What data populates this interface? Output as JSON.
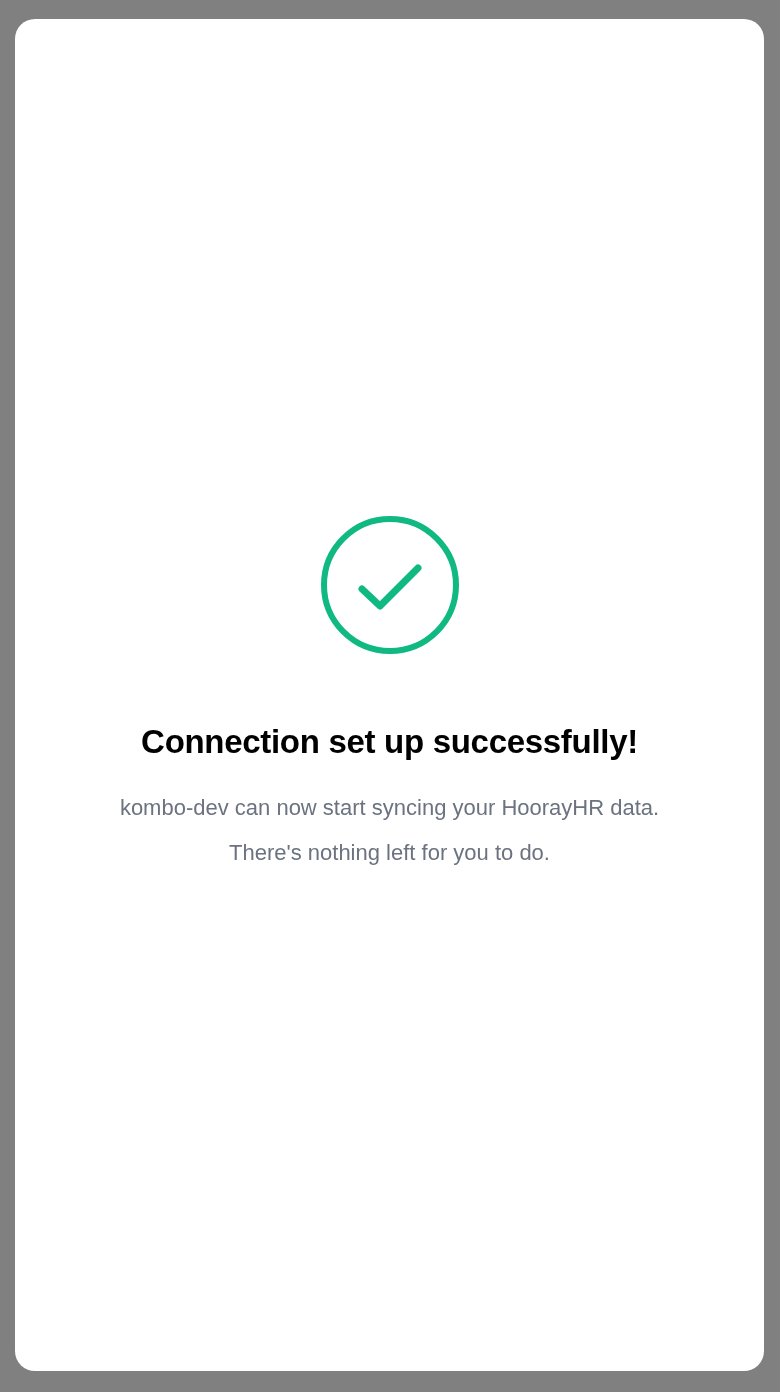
{
  "dialog": {
    "title": "Connection set up successfully!",
    "message": "kombo-dev can now start syncing your HoorayHR data. There's nothing left for you to do."
  }
}
